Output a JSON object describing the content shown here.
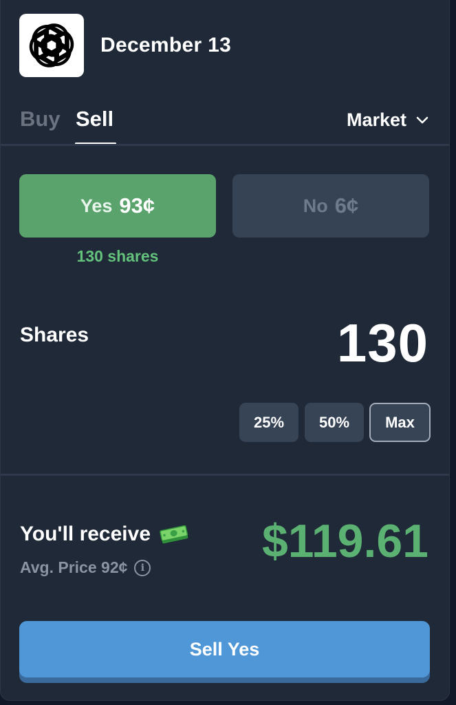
{
  "header": {
    "logo_icon": "openai-knot-icon",
    "title": "December 13"
  },
  "tabs": [
    {
      "label": "Buy",
      "active": false
    },
    {
      "label": "Sell",
      "active": true
    }
  ],
  "order_type": {
    "label": "Market",
    "icon": "chevron-down-icon"
  },
  "outcomes": {
    "yes": {
      "label": "Yes",
      "price": "93¢",
      "color": "#5ba36c",
      "selected": true
    },
    "no": {
      "label": "No",
      "price": "6¢",
      "selected": false
    }
  },
  "position": {
    "shares_owned": "130 shares"
  },
  "shares": {
    "label": "Shares",
    "value": "130",
    "quick_buttons": [
      "25%",
      "50%",
      "Max"
    ],
    "selected_quick": "Max"
  },
  "receive": {
    "label": "You'll receive",
    "icon": "money-icon",
    "avg_price": "Avg. Price 92¢",
    "info_icon": "info-icon",
    "amount": "$119.61",
    "amount_color": "#5bb172"
  },
  "action": {
    "label": "Sell Yes",
    "color": "#4f97d6"
  }
}
